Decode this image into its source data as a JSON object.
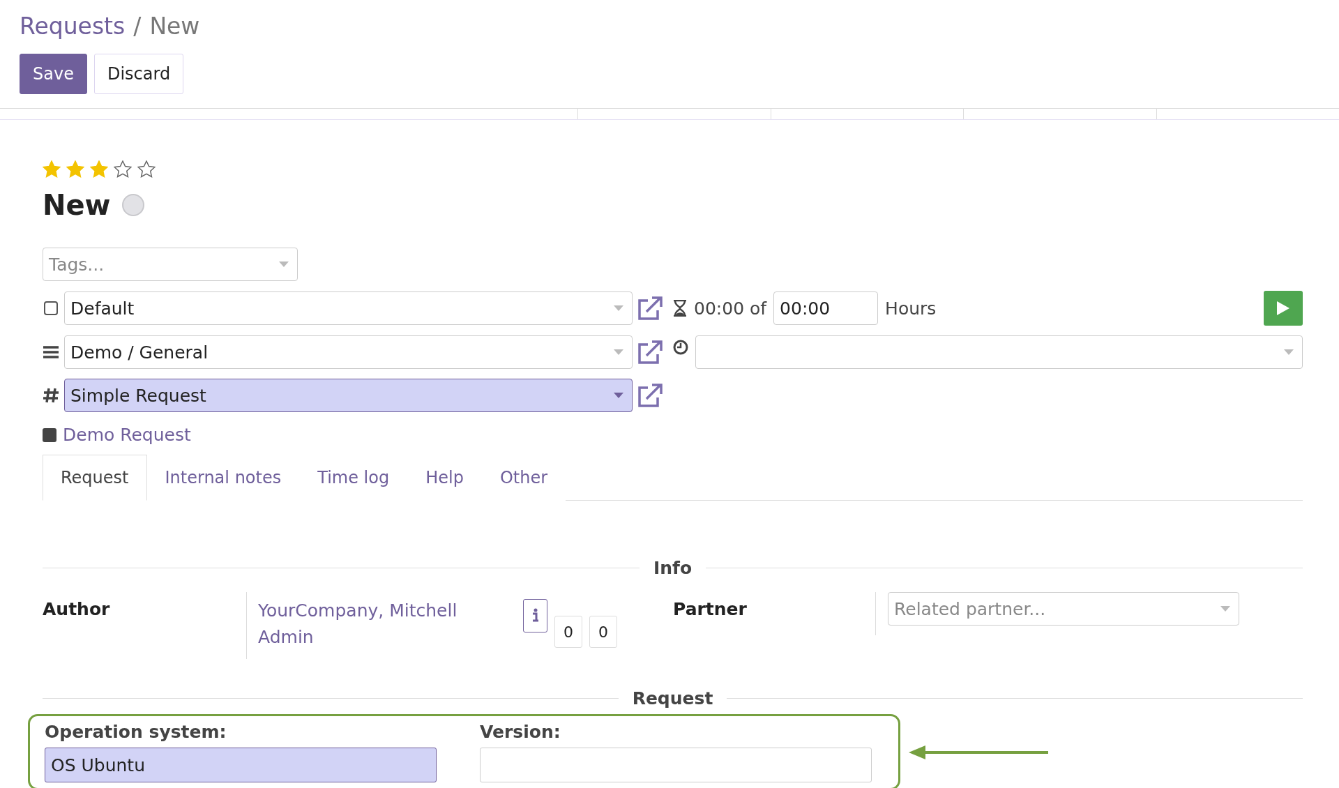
{
  "breadcrumb": {
    "parent": "Requests",
    "separator": "/",
    "current": "New"
  },
  "buttons": [
    {
      "label": "Save",
      "kind": "primary"
    },
    {
      "label": "Discard",
      "kind": "secondary"
    }
  ],
  "stars": 3,
  "title": "New",
  "tags": {
    "placeholder": "Tags..."
  },
  "selects": [
    {
      "kind": "checkbox",
      "checked": false,
      "value": "Default",
      "required": false
    },
    {
      "kind": "category",
      "value": "Demo / General",
      "required": false
    },
    {
      "kind": "type",
      "value": "Simple Request",
      "required": true
    }
  ],
  "timer": {
    "spent": "00:00 of",
    "planned": "00:00",
    "unit": "Hours"
  },
  "related_link": "Demo Request",
  "tabs": [
    {
      "label": "Request",
      "selected": true
    },
    {
      "label": "Internal notes",
      "selected": false
    },
    {
      "label": "Time log",
      "selected": false
    },
    {
      "label": "Help",
      "selected": false
    },
    {
      "label": "Other",
      "selected": false
    }
  ],
  "info": {
    "heading": "Info",
    "author_label": "Author",
    "author_value": "YourCompany, Mitchell Admin",
    "counters": [
      "0",
      "0"
    ],
    "partner_label": "Partner",
    "partner_placeholder": "Related partner..."
  },
  "request": {
    "heading": "Request",
    "fields": [
      {
        "label": "Operation system:",
        "value": "OS Ubuntu",
        "required": true
      },
      {
        "label": "Version:",
        "required": false
      }
    ]
  }
}
